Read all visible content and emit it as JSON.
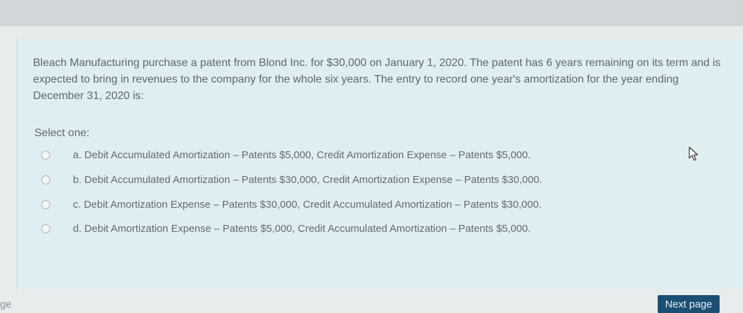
{
  "question": {
    "text": "Bleach Manufacturing purchase a patent from Blond Inc. for $30,000 on January 1, 2020. The patent has 6 years remaining on its term and is expected to bring in revenues to the company for the whole six years. The entry to record one year's amortization for the year ending December 31, 2020 is:",
    "prompt": "Select one:",
    "options": [
      {
        "label": "a. Debit Accumulated Amortization – Patents $5,000, Credit Amortization Expense – Patents $5,000."
      },
      {
        "label": "b. Debit Accumulated Amortization – Patents $30,000, Credit Amortization Expense – Patents $30,000."
      },
      {
        "label": "c. Debit Amortization Expense – Patents $30,000, Credit Accumulated Amortization – Patents $30,000."
      },
      {
        "label": "d. Debit Amortization Expense – Patents $5,000, Credit Accumulated Amortization – Patents $5,000."
      }
    ]
  },
  "footer": {
    "side_text": "ge",
    "next_label": "Next page"
  },
  "icons": {
    "cursor": "mouse-pointer-icon"
  },
  "colors": {
    "card": "#dfeef0",
    "button": "#1b4f73",
    "text": "#5d6770"
  }
}
